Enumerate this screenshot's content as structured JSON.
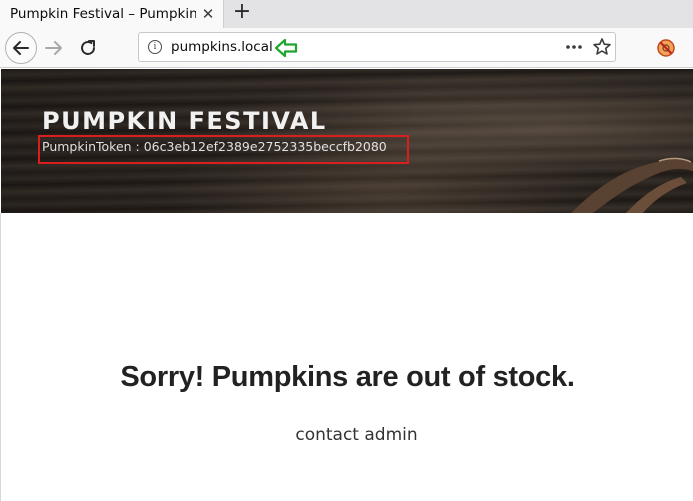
{
  "browser": {
    "tab": {
      "title": "Pumpkin Festival – Pumpkin Festival",
      "close_glyph": "✕"
    },
    "new_tab_glyph": "+",
    "url": "pumpkins.local",
    "icons": {
      "back": "back-arrow-icon",
      "forward": "forward-arrow-icon",
      "reload": "reload-icon",
      "info": "info-icon",
      "annotation": "green-arrow-icon",
      "more": "more-dots-icon",
      "bookmark": "star-icon",
      "addon": "addon-icon"
    },
    "colors": {
      "annotation_arrow": "#1fa52f",
      "highlight_box": "#d91e1e"
    }
  },
  "header": {
    "site_title": "PUMPKIN FESTIVAL",
    "token": "PumpkinToken : 06c3eb12ef2389e2752335beccfb2080"
  },
  "main": {
    "headline": "Sorry! Pumpkins are out of stock.",
    "contact": "contact admin"
  }
}
